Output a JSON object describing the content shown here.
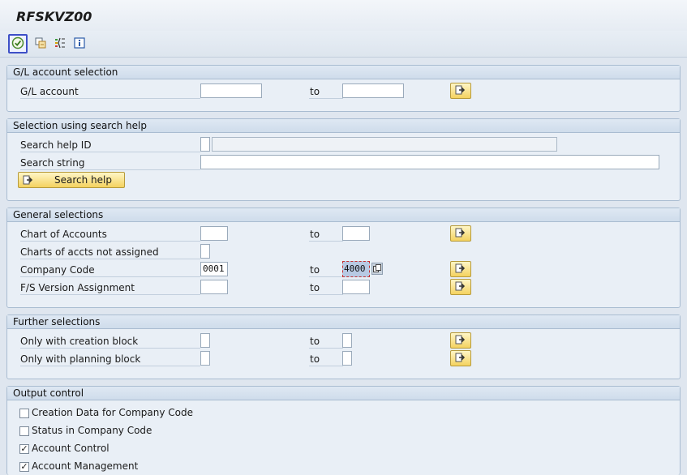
{
  "window": {
    "title": "RFSKVZ00"
  },
  "toolbar": {
    "execute": "execute-icon",
    "variants": "get-variant-icon",
    "selection_options": "selection-options-icon",
    "info": "info-icon"
  },
  "gl_selection": {
    "title": "G/L account selection",
    "gl_account_label": "G/L account",
    "to_label": "to",
    "from_value": "",
    "to_value": ""
  },
  "search_help": {
    "title": "Selection using search help",
    "id_label": "Search help ID",
    "string_label": "Search string",
    "id_value": "",
    "id_desc": "",
    "string_value": "",
    "button_label": "Search help"
  },
  "general": {
    "title": "General selections",
    "chart_label": "Chart of Accounts",
    "not_assigned_label": "Charts of accts not assigned",
    "company_label": "Company Code",
    "fs_label": "F/S Version Assignment",
    "to_label": "to",
    "chart_from": "",
    "chart_to": "",
    "not_assigned_value": "",
    "company_from": "0001",
    "company_to": "4000",
    "fs_from": "",
    "fs_to": ""
  },
  "further": {
    "title": "Further selections",
    "creation_label": "Only with creation block",
    "planning_label": "Only with planning block",
    "to_label": "to",
    "creation_from": "",
    "creation_to": "",
    "planning_from": "",
    "planning_to": ""
  },
  "output": {
    "title": "Output control",
    "items": [
      {
        "label": "Creation Data for Company Code",
        "checked": false
      },
      {
        "label": "Status in Company Code",
        "checked": false
      },
      {
        "label": "Account Control",
        "checked": true
      },
      {
        "label": "Account Management",
        "checked": true
      }
    ]
  },
  "colors": {
    "background": "#dfe6ef",
    "group_border": "#a9bcd1",
    "button_yellow": "#f4d25f",
    "selected_field": "#b8c9e3",
    "active_outline": "#3d4fc7"
  }
}
